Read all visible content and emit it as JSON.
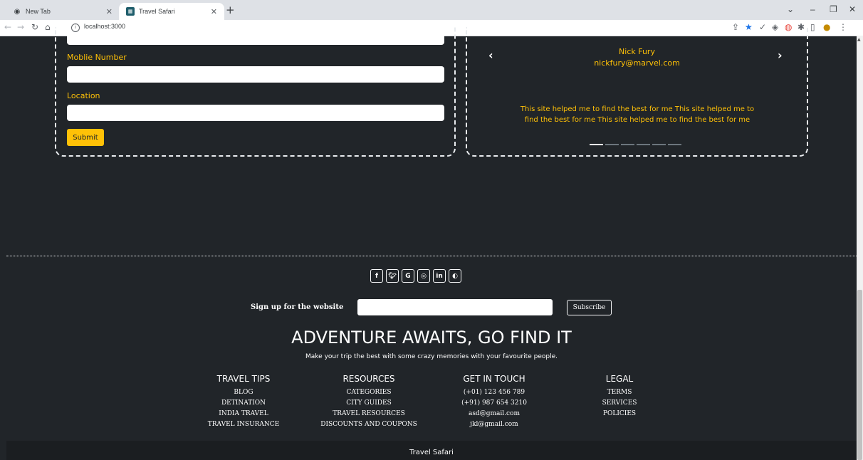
{
  "browser": {
    "tabs": [
      {
        "title": "New Tab",
        "active": false
      },
      {
        "title": "Travel Safari",
        "active": true
      }
    ],
    "url": "localhost:3000"
  },
  "form": {
    "mobile_label": "Moblie Number",
    "location_label": "Location",
    "submit_label": "Submit"
  },
  "testimonial": {
    "name": "Nick Fury",
    "email": "nickfury@marvel.com",
    "text": "This site helped me to find the best for me This site helped me to find the best for me This site helped me to find the best for me",
    "slide_count": 6,
    "active_slide": 1
  },
  "footer": {
    "social_icons": [
      "facebook-icon",
      "twitter-icon",
      "google-icon",
      "instagram-icon",
      "linkedin-icon",
      "github-icon"
    ],
    "signup_label": "Sign up for the website",
    "subscribe_label": "Subscribe",
    "headline": "ADVENTURE AWAITS, GO FIND IT",
    "subline": "Make your trip the best with some crazy memories with your favourite people.",
    "columns": [
      {
        "title": "TRAVEL TIPS",
        "links": [
          "BLOG",
          "DETINATION",
          "INDIA TRAVEL",
          "TRAVEL INSURANCE"
        ]
      },
      {
        "title": "RESOURCES",
        "links": [
          "CATEGORIES",
          "CITY GUIDES",
          "TRAVEL RESOURCES",
          "DISCOUNTS AND COUPONS"
        ]
      },
      {
        "title": "GET IN TOUCH",
        "links": [
          "(+01) 123 456 789",
          "(+91) 987 654 3210",
          "asd@gmail.com",
          "jkl@gmail.com"
        ]
      },
      {
        "title": "LEGAL",
        "links": [
          "TERMS",
          "SERVICES",
          "POLICIES"
        ]
      }
    ],
    "brand": "Travel Safari"
  },
  "colors": {
    "background": "#212529",
    "accent": "#ffc107",
    "bottom_bar": "#1b1e21"
  }
}
